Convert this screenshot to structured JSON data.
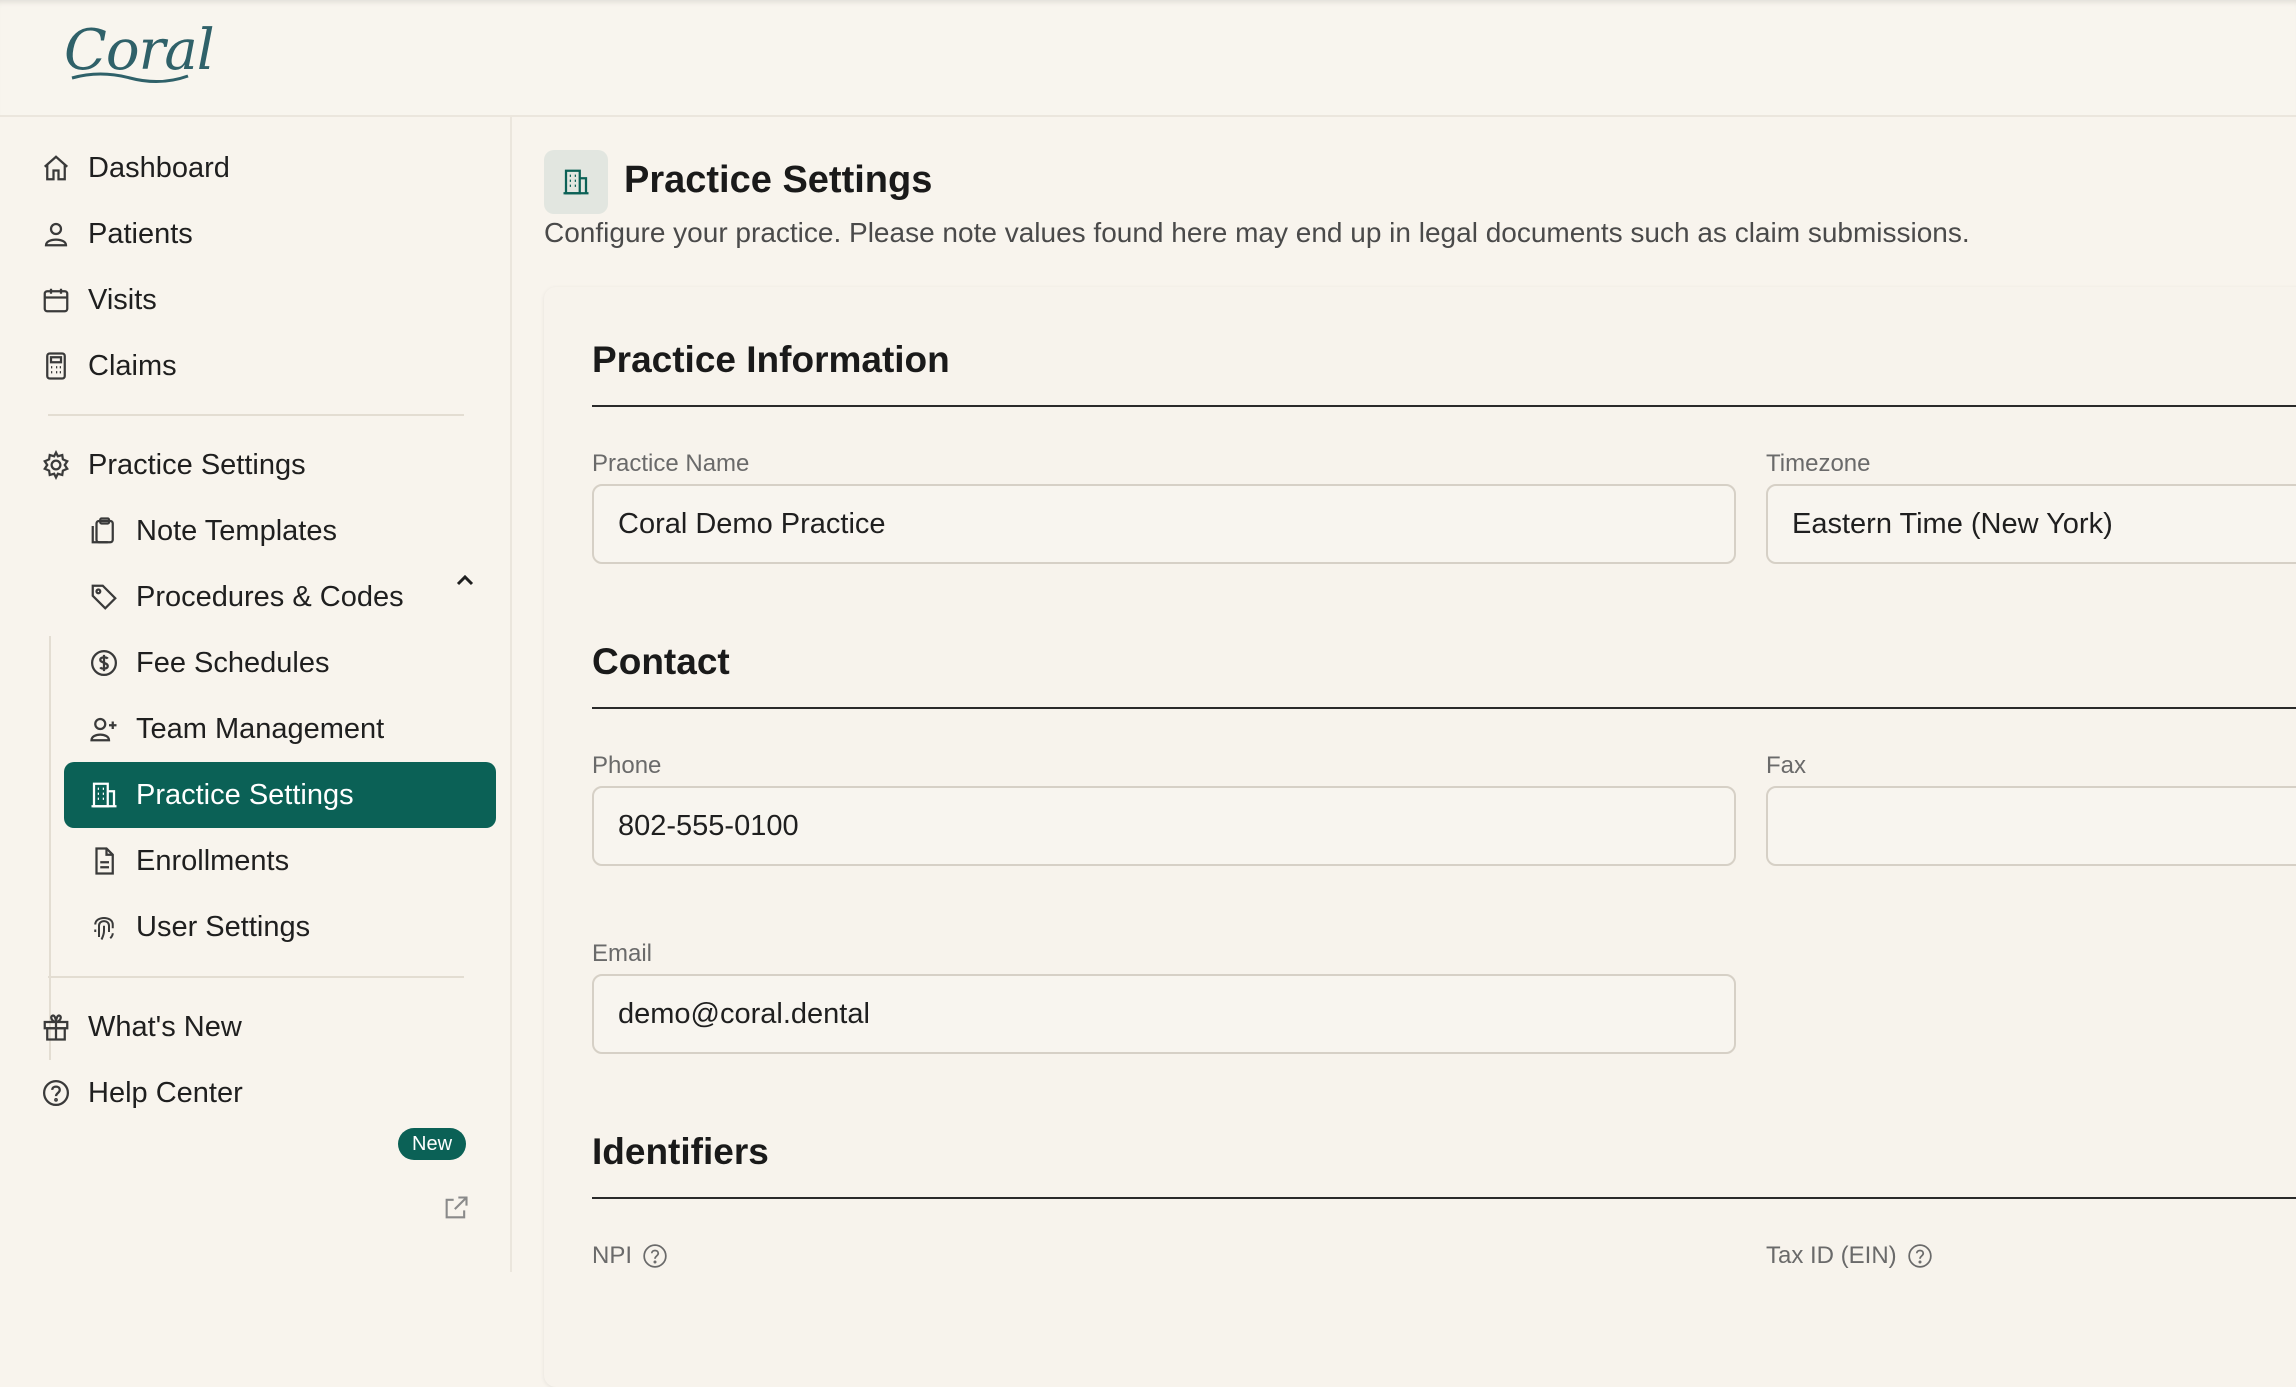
{
  "app": {
    "logo": "Coral"
  },
  "sidebar": {
    "main_items": [
      {
        "label": "Dashboard",
        "icon": "home-icon"
      },
      {
        "label": "Patients",
        "icon": "user-icon"
      },
      {
        "label": "Visits",
        "icon": "calendar-icon"
      },
      {
        "label": "Claims",
        "icon": "calculator-icon"
      }
    ],
    "settings_group": {
      "label": "Practice Settings",
      "icon": "gear-icon",
      "expanded": true
    },
    "settings_items": [
      {
        "label": "Note Templates",
        "icon": "clipboard-icon"
      },
      {
        "label": "Procedures & Codes",
        "icon": "tag-icon"
      },
      {
        "label": "Fee Schedules",
        "icon": "dollar-circle-icon"
      },
      {
        "label": "Team Management",
        "icon": "user-plus-icon"
      },
      {
        "label": "Practice Settings",
        "icon": "building-icon",
        "active": true
      },
      {
        "label": "Enrollments",
        "icon": "document-icon"
      },
      {
        "label": "User Settings",
        "icon": "fingerprint-icon"
      }
    ],
    "whats_new": {
      "label": "What's New",
      "badge": "New",
      "icon": "gift-icon"
    },
    "help_center": {
      "label": "Help Center",
      "icon": "help-circle-icon"
    }
  },
  "page": {
    "title": "Practice Settings",
    "description": "Configure your practice. Please note values found here may end up in legal documents such as claim submissions."
  },
  "sections": {
    "practice_info": {
      "title": "Practice Information",
      "practice_name_label": "Practice Name",
      "practice_name_value": "Coral Demo Practice",
      "timezone_label": "Timezone",
      "timezone_value": "Eastern Time (New York)"
    },
    "contact": {
      "title": "Contact",
      "phone_label": "Phone",
      "phone_value": "802-555-0100",
      "fax_label": "Fax",
      "fax_value": "",
      "email_label": "Email",
      "email_value": "demo@coral.dental"
    },
    "identifiers": {
      "title": "Identifiers",
      "npi_label": "NPI",
      "tax_id_label": "Tax ID (EIN)"
    }
  },
  "colors": {
    "accent": "#0b6156",
    "background": "#f8f4ed",
    "logo": "#2f6169"
  }
}
